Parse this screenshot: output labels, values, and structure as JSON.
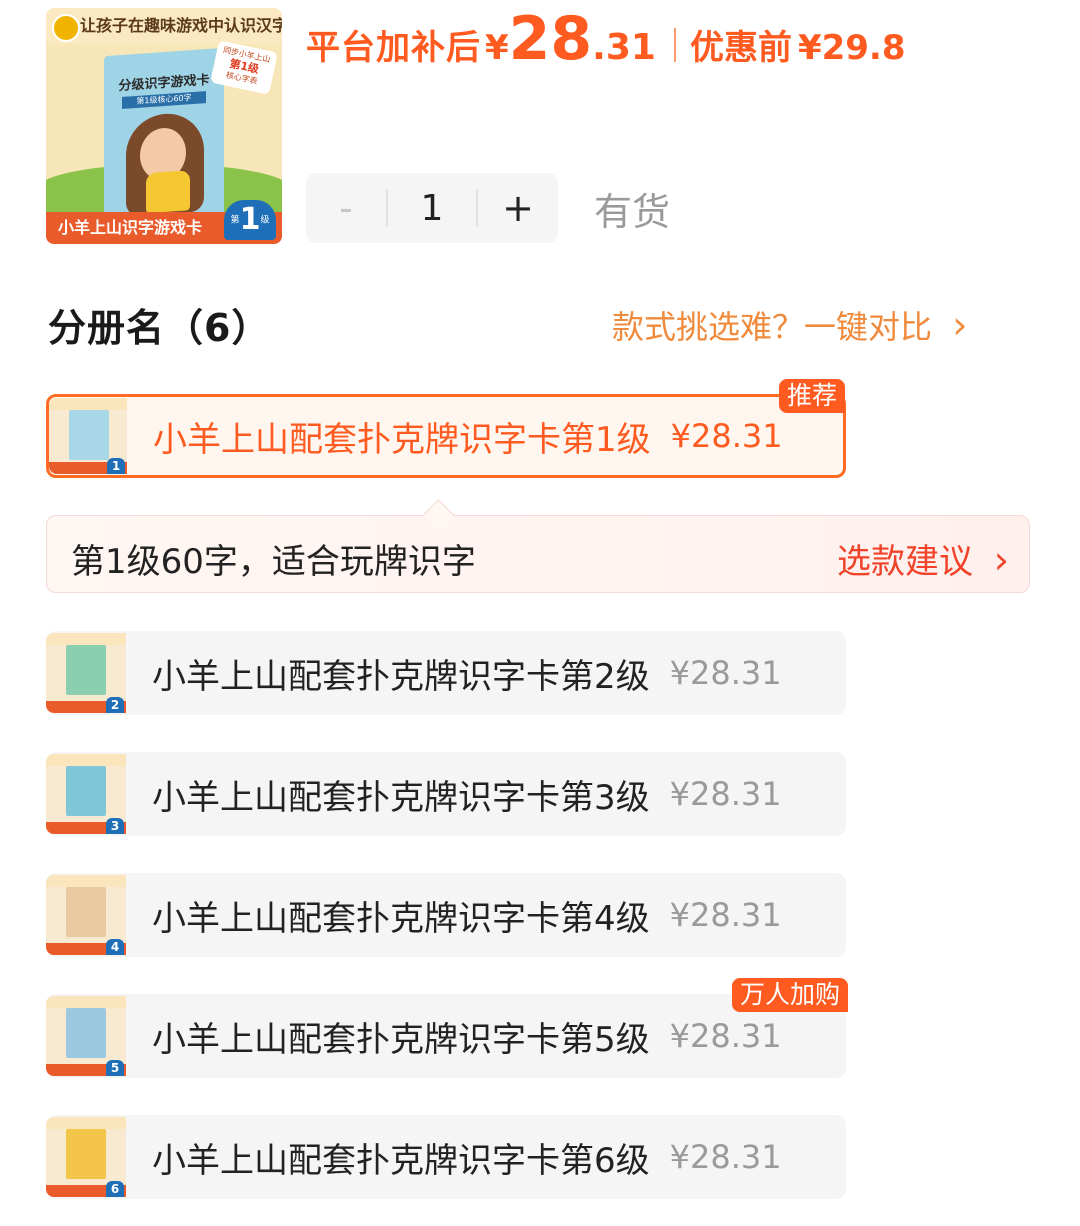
{
  "product": {
    "image_caption_top": "让孩子在趣味游戏中认识汉字",
    "image_box_title": "分级识字游戏卡",
    "image_box_subtitle": "第1级核心60字",
    "image_badge_line1": "同步小羊上山",
    "image_badge_line2": "第1级",
    "image_badge_line3": "核心字表",
    "image_caption_bottom": "小羊上山识字游戏卡",
    "image_level_prefix": "第",
    "image_level_number": "1",
    "image_level_suffix": "级"
  },
  "price": {
    "subsidy_label": "平台加补后",
    "currency": "¥",
    "subsidy_integer": "28",
    "subsidy_decimal": ".31",
    "before_label": "优惠前",
    "before_value": "¥29.8",
    "accent_color": "#ff5a1f"
  },
  "quantity": {
    "minus": "-",
    "value": "1",
    "plus": "+",
    "stock_status": "有货"
  },
  "section": {
    "title": "分册名（6）",
    "compare_link": "款式挑选难？一键对比",
    "compare_chevron": "›"
  },
  "suggestion": {
    "text": "第1级60字，适合玩牌识字",
    "link": "选款建议",
    "chevron": "›"
  },
  "variants": [
    {
      "name": "小羊上山配套扑克牌识字卡第1级",
      "price": "¥28.31",
      "level": "1",
      "tag": "推荐",
      "selected": true,
      "cover_color": "#a8d8e8"
    },
    {
      "name": "小羊上山配套扑克牌识字卡第2级",
      "price": "¥28.31",
      "level": "2",
      "tag": "",
      "selected": false,
      "cover_color": "#8ccfb0"
    },
    {
      "name": "小羊上山配套扑克牌识字卡第3级",
      "price": "¥28.31",
      "level": "3",
      "tag": "",
      "selected": false,
      "cover_color": "#7fc6d6"
    },
    {
      "name": "小羊上山配套扑克牌识字卡第4级",
      "price": "¥28.31",
      "level": "4",
      "tag": "",
      "selected": false,
      "cover_color": "#e8c9a0"
    },
    {
      "name": "小羊上山配套扑克牌识字卡第5级",
      "price": "¥28.31",
      "level": "5",
      "tag": "万人加购",
      "selected": false,
      "cover_color": "#9dc9e0"
    },
    {
      "name": "小羊上山配套扑克牌识字卡第6级",
      "price": "¥28.31",
      "level": "6",
      "tag": "",
      "selected": false,
      "cover_color": "#f3c64a"
    }
  ]
}
